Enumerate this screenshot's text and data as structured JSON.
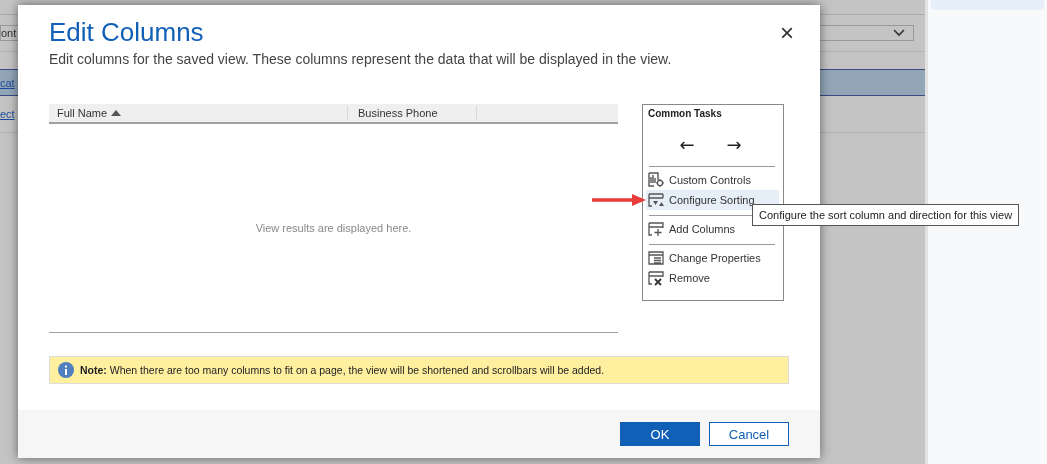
{
  "background": {
    "fragments": [
      {
        "text": "ont",
        "kind": "field"
      },
      {
        "text": "cat",
        "kind": "link",
        "selected": true
      },
      {
        "text": "ect",
        "kind": "link",
        "selected": false
      }
    ]
  },
  "dialog": {
    "title": "Edit Columns",
    "subtitle": "Edit columns for the saved view. These columns represent the data that will be displayed in the view.",
    "close": "×",
    "grid": {
      "columns": [
        {
          "label": "Full Name",
          "sorted": true
        },
        {
          "label": "Business Phone",
          "sorted": false
        }
      ],
      "empty_text": "View results are displayed here."
    },
    "common_tasks": {
      "title": "Common Tasks",
      "move_buttons": [
        "←",
        "→"
      ],
      "groups": [
        [
          {
            "label": "Custom Controls",
            "kind": "controls",
            "highlighted": false
          },
          {
            "label": "Configure Sorting",
            "kind": "sort",
            "highlighted": true
          }
        ],
        [
          {
            "label": "Add Columns",
            "kind": "add",
            "highlighted": false
          }
        ],
        [
          {
            "label": "Change Properties",
            "kind": "properties",
            "highlighted": false
          },
          {
            "label": "Remove",
            "kind": "remove",
            "highlighted": false
          }
        ]
      ]
    },
    "tooltip": "Configure the sort column and direction for this view",
    "note": "**Note:** When there are too many columns to fit on a page, the view will be shortened and scrollbars will be added.",
    "buttons": [
      {
        "label": "OK",
        "kind": "primary"
      },
      {
        "label": "Cancel",
        "kind": "secondary"
      }
    ]
  }
}
